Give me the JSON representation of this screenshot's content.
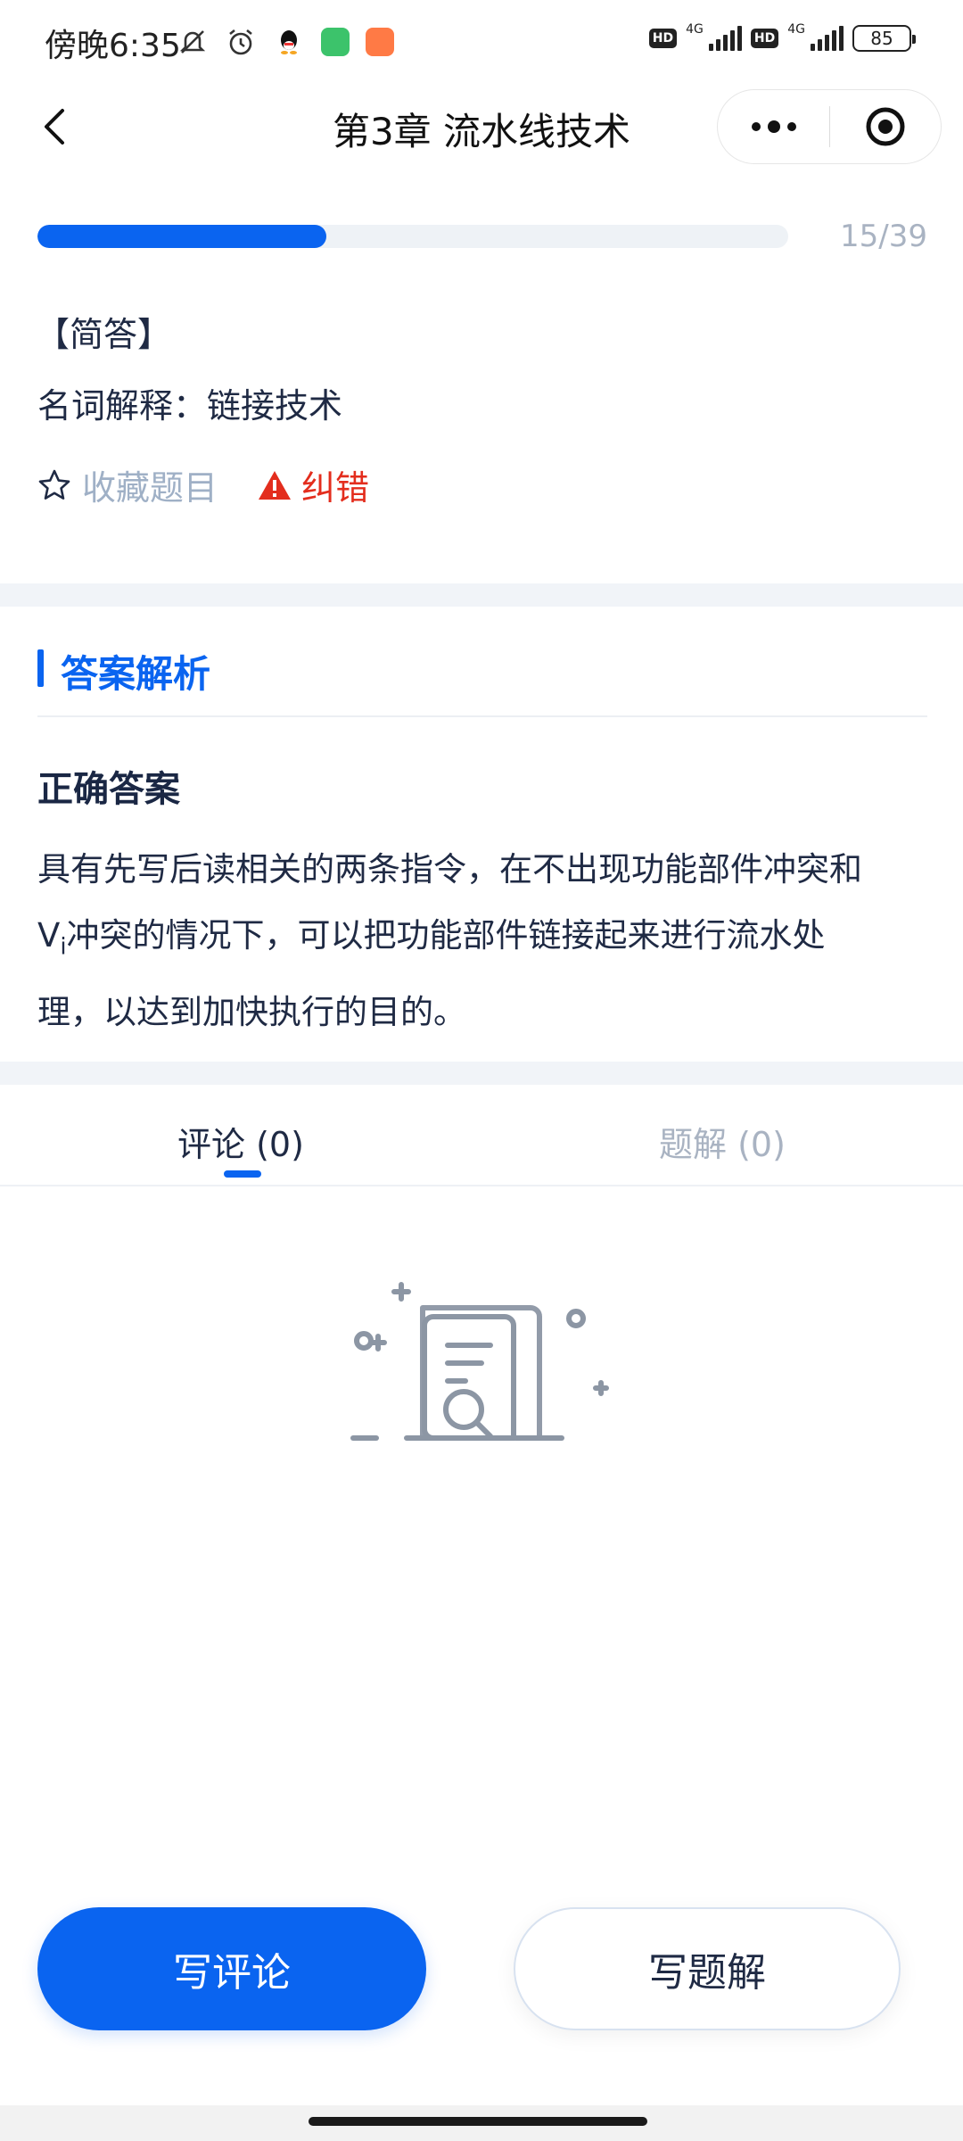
{
  "status_bar": {
    "time": "傍晚6:35",
    "network_1": "4G",
    "network_2": "4G",
    "hd_label_1": "HD",
    "hd_label_2": "HD",
    "battery": "85",
    "icons": [
      "mute-icon",
      "alarm-icon",
      "qq-icon",
      "green-app-icon",
      "orange-app-icon"
    ]
  },
  "nav": {
    "title": "第3章  流水线技术",
    "back_icon": "chevron-left-icon",
    "more_icon": "more-dots-icon",
    "close_icon": "target-close-icon"
  },
  "progress": {
    "current": 15,
    "total": 39,
    "label": "15/39"
  },
  "question": {
    "type": "【简答】",
    "text": "名词解释：链接技术",
    "favorite_label": "收藏题目",
    "report_label": "纠错"
  },
  "answer_section": {
    "title": "答案解析",
    "correct_label": "正确答案",
    "answer_line1": "具有先写后读相关的两条指令，在不出现功能部件冲突和",
    "answer_v": "V",
    "answer_sub": "i",
    "answer_line2_rest": "冲突的情况下，可以把功能部件链接起来进行流水处",
    "answer_line3": "理，以达到加快执行的目的。"
  },
  "tabs": [
    {
      "label": "评论 (0)",
      "active": true
    },
    {
      "label": "题解 (0)",
      "active": false
    }
  ],
  "buttons": {
    "write_comment": "写评论",
    "write_solution": "写题解"
  },
  "colors": {
    "accent": "#0a64f0",
    "danger": "#e32d1d",
    "muted": "#a9b3c2"
  }
}
